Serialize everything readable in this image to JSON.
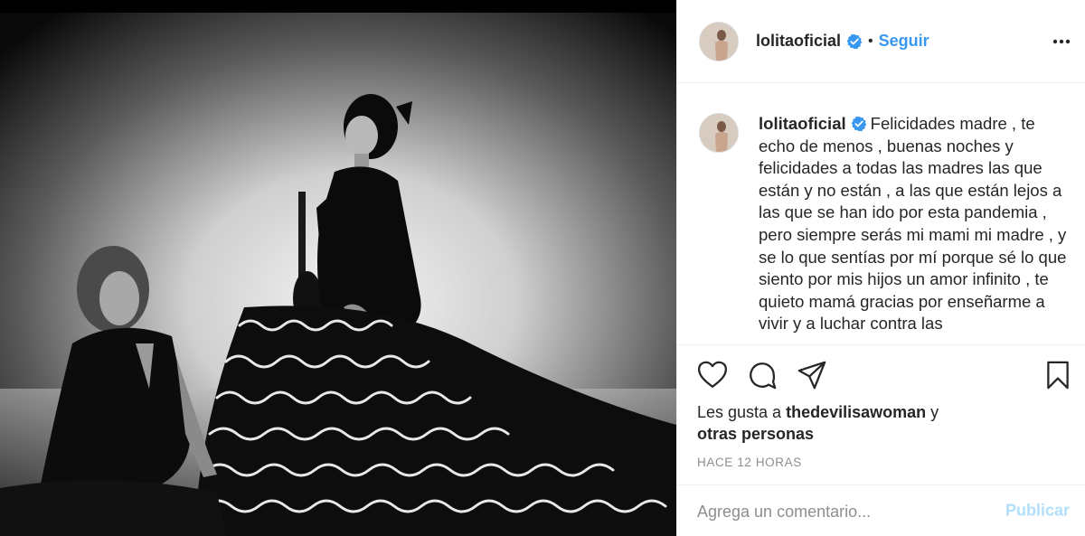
{
  "post": {
    "image_alt": "",
    "username": "lolitaoficial",
    "separator": "•",
    "follow_label": "Seguir",
    "caption": "Felicidades madre , te echo de menos , buenas noches y felicidades a todas las madres las que están y no están , a las que están lejos a las que se han ido por esta pandemia , pero siempre serás mi mami mi madre , y se lo que sentías por mí porque sé lo que siento por mis hijos un amor infinito , te quieto mamá gracias por enseñarme a vivir y a luchar contra las",
    "likes_prefix": "Les gusta a",
    "likes_user": "thedevilisawoman",
    "likes_and": "y",
    "likes_others": "otras personas",
    "timestamp": "HACE 12 HORAS"
  },
  "comment": {
    "placeholder": "Agrega un comentario...",
    "publish_label": "Publicar"
  },
  "icons": {
    "verified": "verified-badge-icon",
    "more": "more-options-icon",
    "like": "heart-icon",
    "comment": "comment-icon",
    "share": "share-icon",
    "save": "bookmark-icon"
  },
  "colors": {
    "accent": "#3897f0",
    "publish_disabled": "#b2dffc",
    "muted": "#8e8e8e",
    "text": "#262626",
    "border": "#efefef"
  }
}
